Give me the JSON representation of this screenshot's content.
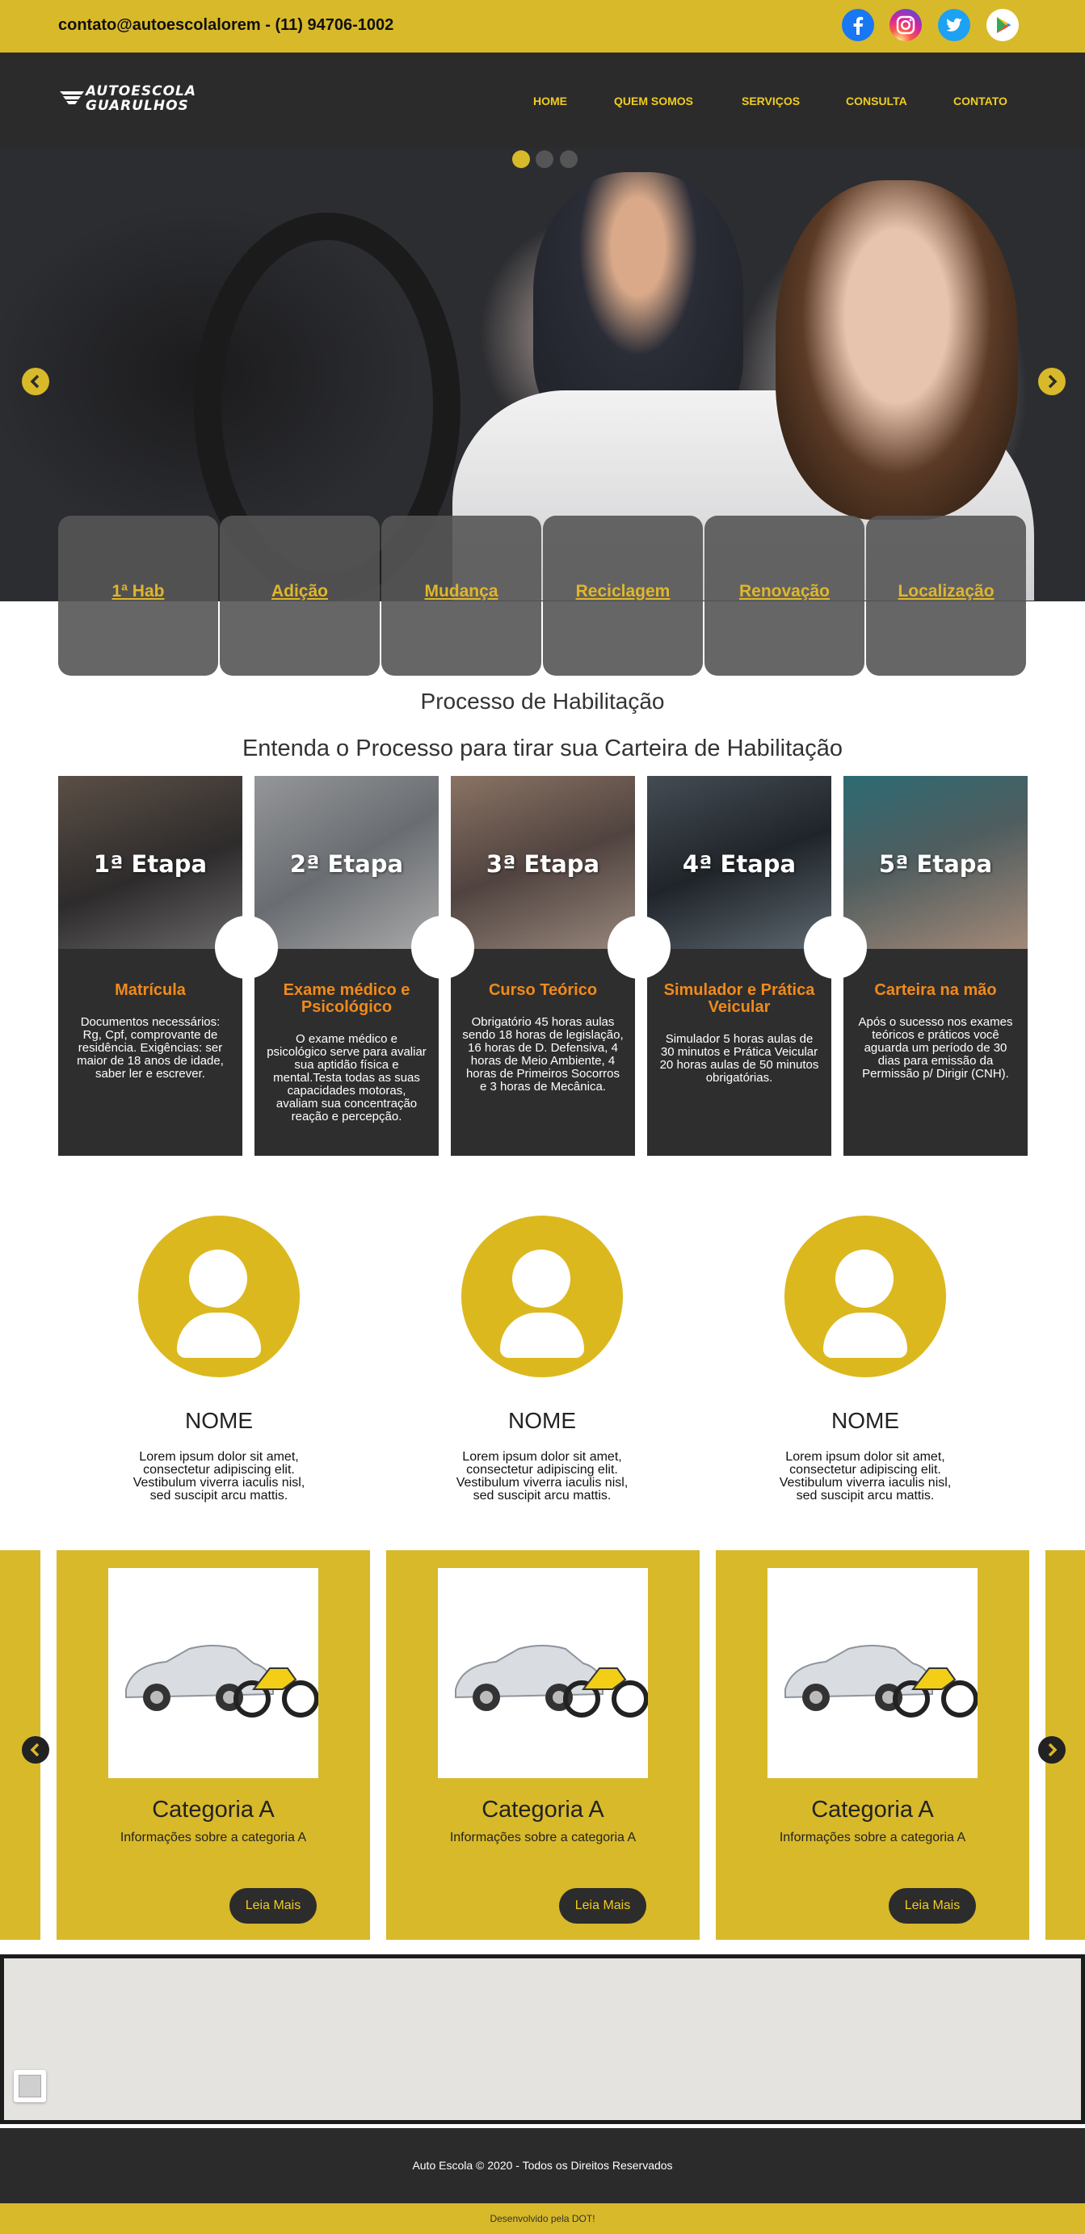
{
  "topbar": {
    "contact": "contato@autoescolalorem - (11) 94706-1002",
    "social": [
      {
        "icon": "facebook-icon",
        "color": "#1877f2"
      },
      {
        "icon": "instagram-icon",
        "color": "#d6249f"
      },
      {
        "icon": "twitter-icon",
        "color": "#1da1f2"
      },
      {
        "icon": "google-play-icon",
        "color": "#ffffff"
      }
    ]
  },
  "header": {
    "logo_line1": "AUTOESCOLA",
    "logo_line2": "GUARULHOS",
    "nav": [
      "HOME",
      "QUEM SOMOS",
      "SERVIÇOS",
      "CONSULTA",
      "CONTATO"
    ]
  },
  "hero": {
    "slide_count": 3,
    "active_slide": 1
  },
  "services": [
    "1ª Hab",
    "Adição",
    "Mudança",
    "Reciclagem",
    "Renovação",
    "Localização"
  ],
  "process": {
    "title": "Processo de Habilitação",
    "subtitle": "Entenda o Processo para tirar sua Carteira de Habilitação",
    "steps": [
      {
        "etapa": "1ª Etapa",
        "title": "Matrícula",
        "text": "Documentos necessários: Rg, Cpf, comprovante de residência. Exigências: ser maior de 18 anos de idade, saber ler e escrever."
      },
      {
        "etapa": "2ª Etapa",
        "title": "Exame médico e Psicológico",
        "text": "O exame médico e psicológico serve para avaliar sua aptidão física e mental.Testa todas as suas capacidades motoras, avaliam sua concentração reação e percepção."
      },
      {
        "etapa": "3ª Etapa",
        "title": "Curso Teórico",
        "text": "Obrigatório 45 horas aulas sendo 18 horas de legislação, 16 horas de D. Defensiva, 4 horas de Meio Ambiente, 4 horas de Primeiros Socorros e 3 horas de Mecânica."
      },
      {
        "etapa": "4ª Etapa",
        "title": "Simulador e Prática Veicular",
        "text": "Simulador 5 horas aulas de 30 minutos e Prática Veicular 20 horas aulas de 50 minutos obrigatórias."
      },
      {
        "etapa": "5ª Etapa",
        "title": "Carteira na mão",
        "text": "Após o sucesso nos exames teóricos e práticos você aguarda um período de 30 dias para emissão da Permissão p/ Dirigir (CNH)."
      }
    ]
  },
  "team": [
    {
      "name": "NOME",
      "text": "Lorem ipsum dolor sit amet, consectetur adipiscing elit. Vestibulum viverra iaculis nisl, sed suscipit arcu mattis."
    },
    {
      "name": "NOME",
      "text": "Lorem ipsum dolor sit amet, consectetur adipiscing elit. Vestibulum viverra iaculis nisl, sed suscipit arcu mattis."
    },
    {
      "name": "NOME",
      "text": "Lorem ipsum dolor sit amet, consectetur adipiscing elit. Vestibulum viverra iaculis nisl, sed suscipit arcu mattis."
    }
  ],
  "categories": [
    {
      "title": "Categoria A",
      "desc": "Informações sobre a categoria A",
      "button": "Leia Mais"
    },
    {
      "title": "Categoria A",
      "desc": "Informações sobre a categoria A",
      "button": "Leia Mais"
    },
    {
      "title": "Categoria A",
      "desc": "Informações sobre a categoria A",
      "button": "Leia Mais"
    }
  ],
  "footer": {
    "copyright": "Auto Escola © 2020 - Todos os Direitos Reservados",
    "developer": "Desenvolvido pela DOT!"
  },
  "colors": {
    "accent": "#d8b92a",
    "dark": "#2b2b2b",
    "orange": "#f08a1b",
    "nav": "#f1cc20"
  }
}
